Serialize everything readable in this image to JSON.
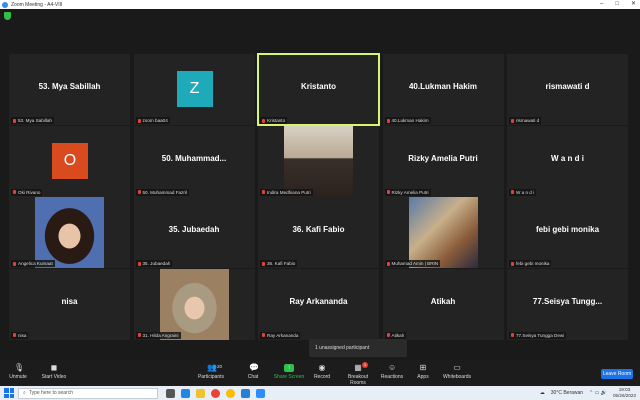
{
  "window": {
    "title": "Zoom Meeting - A4-VIII"
  },
  "tiles": [
    {
      "big": "53. Mya Sabillah",
      "label": "53. Mya Sabillah"
    },
    {
      "avatar": "Z",
      "color": "#1eaab8",
      "label": "zoom baa04"
    },
    {
      "big": "Kristanto",
      "label": "Kristanto",
      "active": true
    },
    {
      "big": "40.Lukman Hakim",
      "label": "40.Lukman Hakim"
    },
    {
      "big": "rismawati d",
      "label": "rismawati d"
    },
    {
      "avatar": "O",
      "color": "#d94a1e",
      "label": "Oki Rivano"
    },
    {
      "big": "50.  Muhammad...",
      "label": "50. Muhammad Fazril"
    },
    {
      "video": "v1",
      "label": "Indira Medhiana Putri"
    },
    {
      "big": "Rizky Amelia Putri",
      "label": "Rizky Amelia Putri"
    },
    {
      "big": "W a n d i",
      "label": "W a n d i"
    },
    {
      "video": "v2",
      "label": "Angelica Kumaat"
    },
    {
      "big": "35. Jubaedah",
      "label": "35. Jubaedah"
    },
    {
      "big": "36. Kafi Fabio",
      "label": "36. Kafi Fabio"
    },
    {
      "video": "v3",
      "label": "Muhamad Amin | BRIN"
    },
    {
      "big": "febi gebi monika",
      "label": "febi gebi monika"
    },
    {
      "big": "nisa",
      "label": "nisa"
    },
    {
      "video": "v4",
      "label": "31. Hilda Angraini"
    },
    {
      "big": "Ray Arkananda",
      "label": "Ray Arkananda"
    },
    {
      "big": "Atikah",
      "label": "Atikah"
    },
    {
      "big": "77.Seisya  Tungg...",
      "label": "77.Seisya Tungga Dewi"
    }
  ],
  "share_notice": "1 unassigned participant",
  "toolbar": {
    "unmute": "Unmute",
    "start_video": "Start Video",
    "participants": "Participants",
    "participants_count": "20",
    "chat": "Chat",
    "share": "Share Screen",
    "record": "Record",
    "breakout": "Breakout Rooms",
    "breakout_badge": "1",
    "reactions": "Reactions",
    "apps": "Apps",
    "whiteboards": "Whiteboards",
    "leave": "Leave Room"
  },
  "taskbar": {
    "search_placeholder": "Type here to search",
    "weather": "30°C  Berawan",
    "time": "19:03",
    "date": "05/26/2023"
  }
}
